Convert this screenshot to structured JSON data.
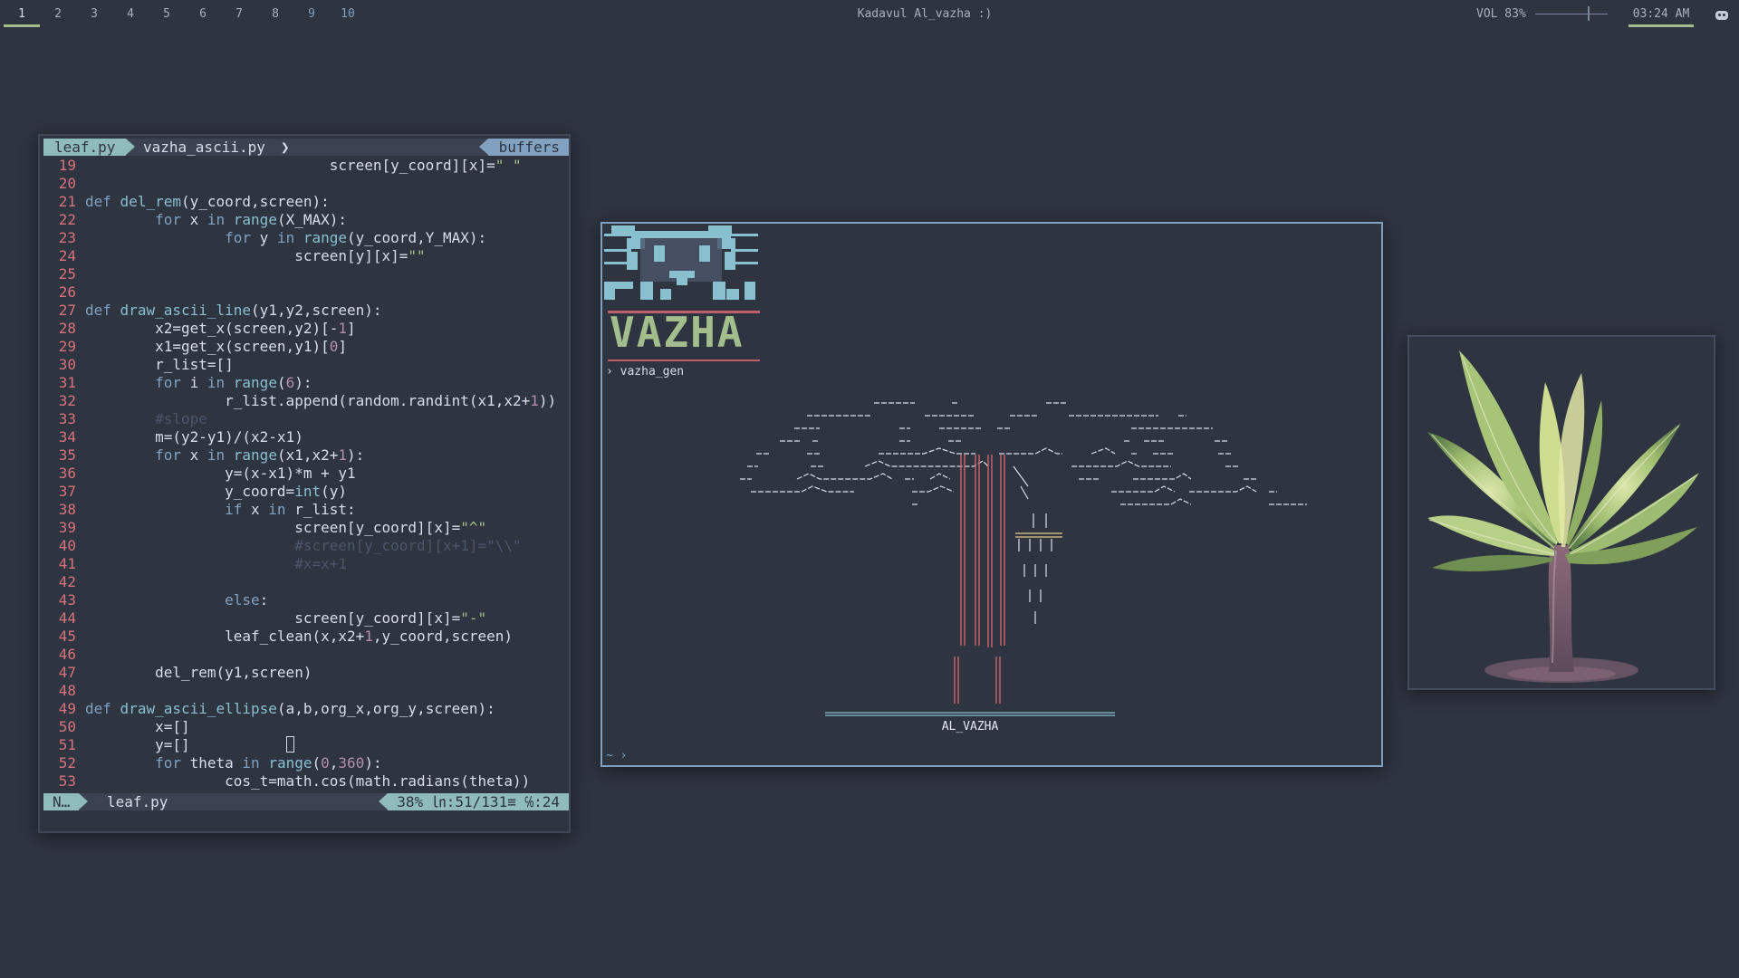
{
  "topbar": {
    "workspaces": [
      "1",
      "2",
      "3",
      "4",
      "5",
      "6",
      "7",
      "8",
      "9",
      "10"
    ],
    "active_workspace": "1",
    "window_title": "Kadavul Al_vazha :)",
    "volume": "VOL 83%",
    "volume_level": 0.83,
    "clock": "03:24 AM",
    "tray_icon": "discord-icon"
  },
  "editor": {
    "tabs": [
      "leaf.py",
      "vazha_ascii.py"
    ],
    "buffers_label": "buffers",
    "status": {
      "mode": "N…",
      "file": "leaf.py",
      "position": "38% ㏑:51/131≡ ℅:24"
    }
  },
  "terminal": {
    "logo_word": "VAZHA",
    "command": "vazha_gen",
    "prompt_glyph": "›",
    "banner_label": "AL_VAZHA",
    "bottom_prompt": "~ ›"
  },
  "photo": {
    "subject": "banana plant"
  },
  "colors": {
    "background": "#2e3440",
    "accent": "#8fbcbb",
    "line_number": "#d9737b",
    "keyword": "#81a1c1",
    "string": "#a3be8c",
    "number": "#b48ead"
  }
}
